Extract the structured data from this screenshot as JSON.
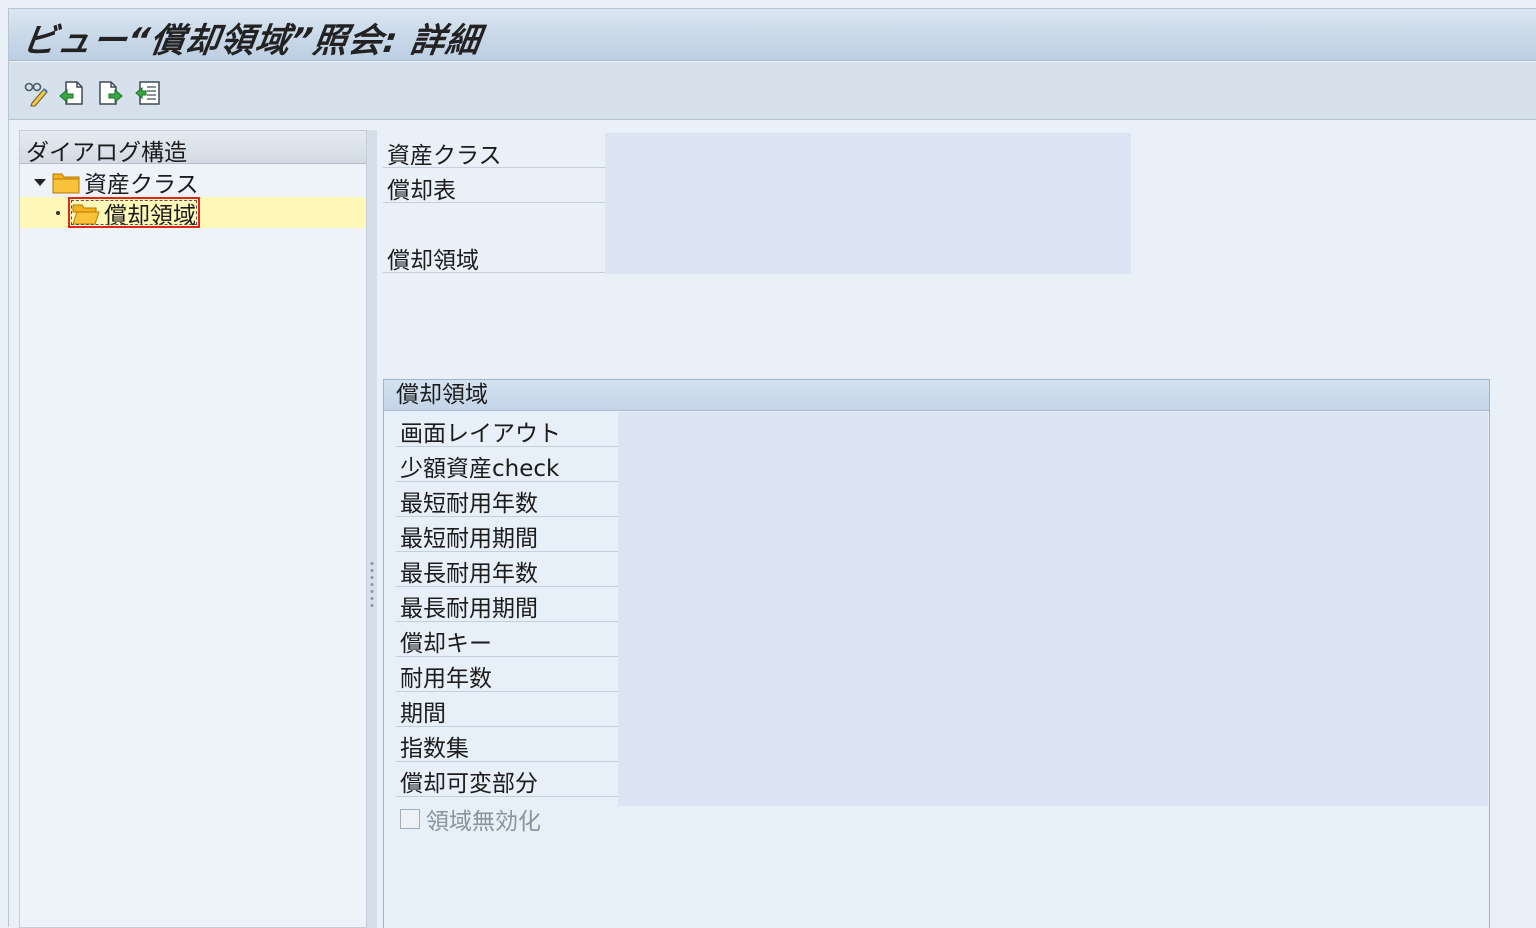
{
  "window": {
    "title": "ビュー“償却領域”照会: 詳細"
  },
  "toolbar": {
    "buttons": [
      {
        "icon": "display-change-icon"
      },
      {
        "icon": "previous-entry-icon"
      },
      {
        "icon": "next-entry-icon"
      },
      {
        "icon": "select-all-icon"
      }
    ]
  },
  "tree": {
    "header": "ダイアログ構造",
    "root_label": "資産クラス",
    "child_label": "償却領域"
  },
  "header_form": {
    "asset_class_label": "資産クラス",
    "dep_chart_label": "償却表",
    "dep_area_label": "償却領域"
  },
  "group": {
    "title": "償却領域",
    "fields": [
      "画面レイアウト",
      "少額資産check",
      "最短耐用年数",
      "最短耐用期間",
      "最長耐用年数",
      "最長耐用期間",
      "償却キー",
      "耐用年数",
      "期間",
      "指数集",
      "償却可変部分"
    ],
    "checkbox_label": "領域無効化",
    "checkbox_checked": false
  },
  "colors": {
    "selection_highlight": "#fdf7b8",
    "selection_border": "#e0251b",
    "value_field_bg": "#dbe4f3",
    "folder_yellow": "#f5b21a"
  }
}
